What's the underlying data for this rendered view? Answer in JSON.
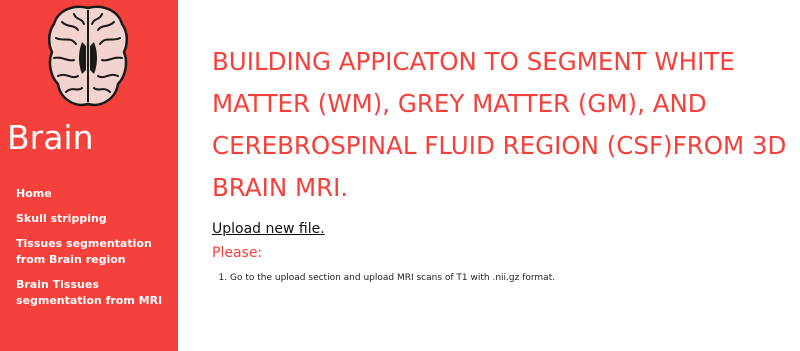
{
  "sidebar": {
    "brand": "Brain",
    "logo_icon": "brain-icon",
    "nav": [
      {
        "label": "Home"
      },
      {
        "label": "Skull stripping"
      },
      {
        "label": "Tissues segmentation from Brain region"
      },
      {
        "label": "Brain Tissues segmentation from MRI"
      }
    ]
  },
  "main": {
    "title": "BUILDING APPICATON TO SEGMENT WHITE MATTER (WM), GREY MATTER (GM), AND CEREBROSPINAL FLUID REGION (CSF)FROM 3D BRAIN MRI.",
    "upload_link": "Upload new file.",
    "please_label": "Please:",
    "steps": [
      "Go to the upload section and upload MRI scans of T1 with .nii.gz format."
    ]
  },
  "colors": {
    "accent": "#f4413b",
    "sidebar_text": "#ffffff"
  }
}
